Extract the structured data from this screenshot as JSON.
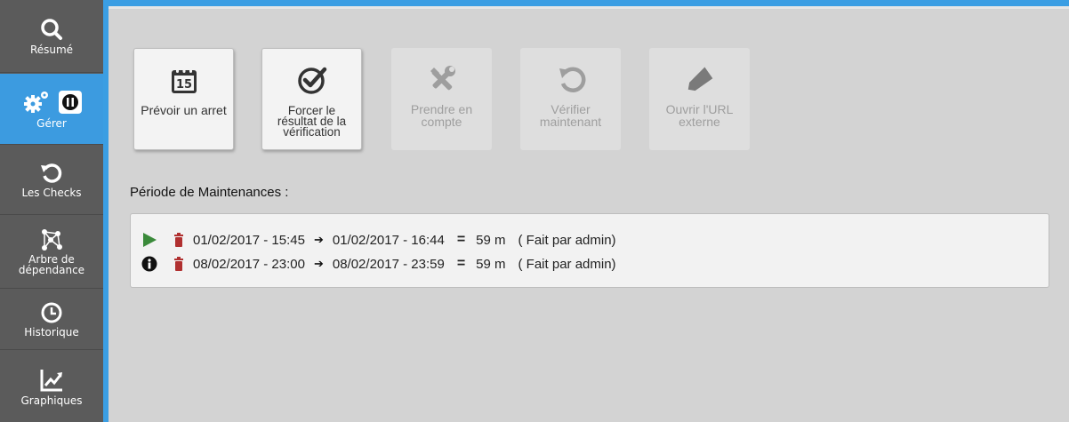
{
  "sidebar": {
    "items": [
      {
        "label": "Résumé",
        "icon": "search-icon"
      },
      {
        "label": "Gérer",
        "icon": "gears-icon",
        "active": true
      },
      {
        "label": "Les Checks",
        "icon": "refresh-icon"
      },
      {
        "label": "Arbre de dépendance",
        "icon": "dependency-tree-icon"
      },
      {
        "label": "Historique",
        "icon": "clock-icon"
      },
      {
        "label": "Graphiques",
        "icon": "chart-icon"
      }
    ]
  },
  "actions": {
    "schedule_downtime": "Prévoir un arret",
    "force_result": "Forcer le résultat de la vérification",
    "acknowledge": "Prendre en compte",
    "check_now": "Vérifier maintenant",
    "open_url": "Ouvrir l'URL externe",
    "calendar_day": "15"
  },
  "maintenance": {
    "title": "Période de Maintenances :",
    "rows": [
      {
        "status": "play-icon",
        "start": "01/02/2017 - 15:45",
        "end": "01/02/2017 - 16:44",
        "duration": "59 m",
        "by": "( Fait par admin)"
      },
      {
        "status": "info-icon",
        "start": "08/02/2017 - 23:00",
        "end": "08/02/2017 - 23:59",
        "duration": "59 m",
        "by": "( Fait par admin)"
      }
    ]
  },
  "colors": {
    "accent": "#3b9ee3",
    "sidebar_bg": "#5b5b5b",
    "play_green": "#3a8a3a",
    "trash_red": "#b03030"
  }
}
